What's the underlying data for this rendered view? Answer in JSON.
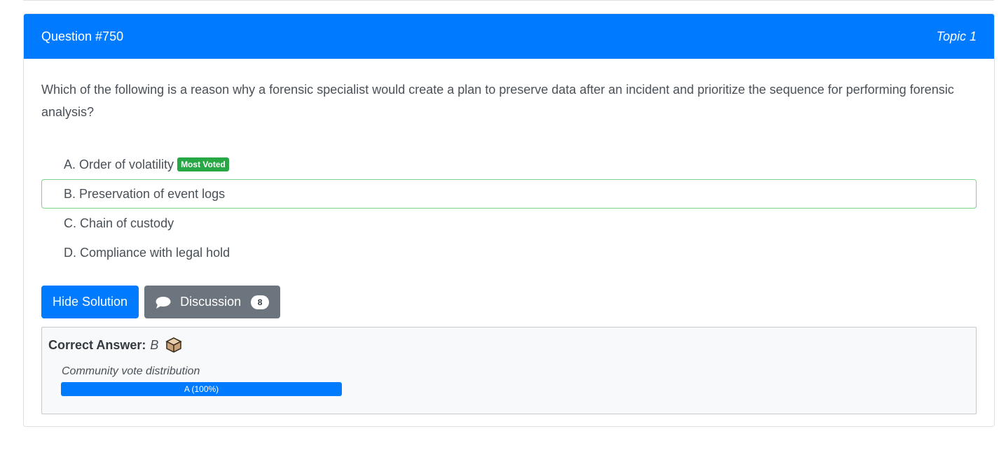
{
  "header": {
    "question_label": "Question #750",
    "topic_label": "Topic 1"
  },
  "question": {
    "text": "Which of the following is a reason why a forensic specialist would create a plan to preserve data after an incident and prioritize the sequence for performing forensic analysis?"
  },
  "choices": [
    {
      "label": "A. Order of volatility",
      "badge": "Most Voted"
    },
    {
      "label": "B. Preservation of event logs"
    },
    {
      "label": "C. Chain of custody"
    },
    {
      "label": "D. Compliance with legal hold"
    }
  ],
  "buttons": {
    "hide_solution": "Hide Solution",
    "discussion": "Discussion",
    "discussion_count": "8"
  },
  "answer": {
    "label": "Correct Answer:",
    "value": "B",
    "icon": "box-icon"
  },
  "votes": {
    "title": "Community vote distribution",
    "bar_label": "A (100%)",
    "fraction": 1.0
  },
  "colors": {
    "primary": "#007bff",
    "success": "#28a745",
    "secondary": "#6c757d"
  }
}
